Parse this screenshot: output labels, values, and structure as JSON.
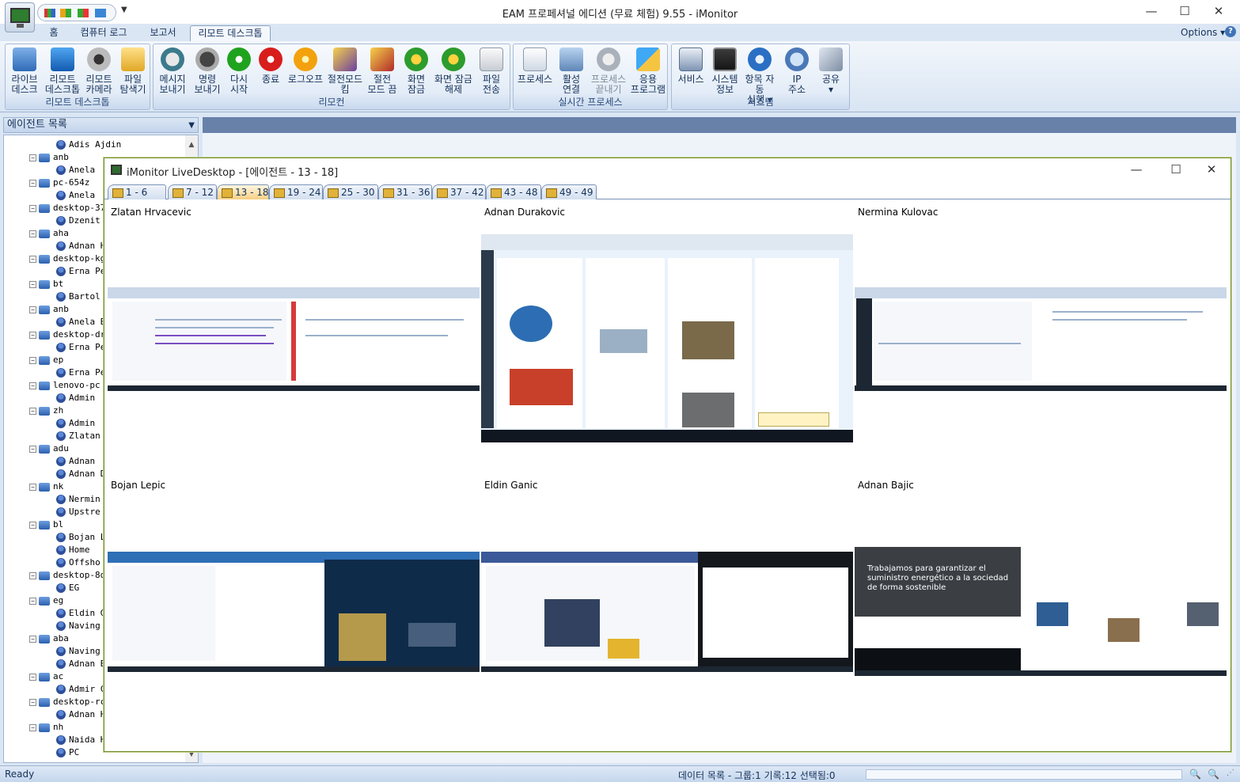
{
  "app": {
    "title": "EAM 프로페셔널 에디션 (무료 체험) 9.55 - iMonitor",
    "options_label": "Options",
    "help_glyph": "?"
  },
  "ribbon_tabs": [
    {
      "label": "홈",
      "active": false
    },
    {
      "label": "컴퓨터 로그",
      "active": false
    },
    {
      "label": "보고서",
      "active": false
    },
    {
      "label": "리모트 데스크톱",
      "active": true
    }
  ],
  "ribbon_groups": [
    {
      "label": "리모트 데스크톱",
      "buttons": [
        {
          "label": "라이브\n데스크",
          "icon": "monitor-icon"
        },
        {
          "label": "리모트\n데스크톱",
          "icon": "remote-desktop-icon"
        },
        {
          "label": "리모트\n카메라",
          "icon": "webcam-icon"
        },
        {
          "label": "파일\n탐색기",
          "icon": "folder-icon"
        }
      ]
    },
    {
      "label": "리모컨",
      "buttons": [
        {
          "label": "메시지\n보내기",
          "icon": "message-icon"
        },
        {
          "label": "명령\n보내기",
          "icon": "command-icon"
        },
        {
          "label": "다시\n시작",
          "icon": "restart-icon"
        },
        {
          "label": "종료",
          "icon": "power-icon"
        },
        {
          "label": "로그오프",
          "icon": "logoff-icon"
        },
        {
          "label": "절전모드\n킴",
          "icon": "sleep-on-icon"
        },
        {
          "label": "절전\n모드 끔",
          "icon": "sleep-off-icon"
        },
        {
          "label": "화면\n잠금",
          "icon": "lock-screen-icon"
        },
        {
          "label": "화면 잠금\n해제",
          "icon": "unlock-screen-icon"
        },
        {
          "label": "파일\n전송",
          "icon": "file-transfer-icon"
        }
      ]
    },
    {
      "label": "실시간 프로세스",
      "buttons": [
        {
          "label": "프로세스",
          "icon": "process-icon"
        },
        {
          "label": "활성\n연결",
          "icon": "connection-icon"
        },
        {
          "label": "프로세스\n끝내기",
          "icon": "kill-process-icon",
          "disabled": true
        },
        {
          "label": "응용\n프로그램",
          "icon": "application-icon"
        }
      ]
    },
    {
      "label": "시스템",
      "buttons": [
        {
          "label": "서비스",
          "icon": "services-icon"
        },
        {
          "label": "시스템\n정보",
          "icon": "system-info-icon"
        },
        {
          "label": "항목 자동\n실행 ▾",
          "icon": "autorun-icon"
        },
        {
          "label": "IP\n주소",
          "icon": "ip-address-icon"
        },
        {
          "label": "공유\n▾",
          "icon": "share-icon"
        }
      ]
    }
  ],
  "agent_pane": {
    "title": "에이전트 목록",
    "nodes": [
      {
        "label": "Adis Ajdin",
        "level": 2
      },
      {
        "label": "anb",
        "level": 1
      },
      {
        "label": "Anela",
        "level": 2
      },
      {
        "label": "pc-654z",
        "level": 1
      },
      {
        "label": "Anela",
        "level": 2
      },
      {
        "label": "desktop-37",
        "level": 1
      },
      {
        "label": "Dzenit",
        "level": 2
      },
      {
        "label": "aha",
        "level": 1
      },
      {
        "label": "Adnan H",
        "level": 2
      },
      {
        "label": "desktop-kg",
        "level": 1
      },
      {
        "label": "Erna Pe",
        "level": 2
      },
      {
        "label": "bt",
        "level": 1
      },
      {
        "label": "Bartol",
        "level": 2
      },
      {
        "label": "anb",
        "level": 1
      },
      {
        "label": "Anela B",
        "level": 2
      },
      {
        "label": "desktop-dr",
        "level": 1
      },
      {
        "label": "Erna Pe",
        "level": 2
      },
      {
        "label": "ep",
        "level": 1
      },
      {
        "label": "Erna Pe",
        "level": 2
      },
      {
        "label": "lenovo-pc",
        "level": 1
      },
      {
        "label": "Admin",
        "level": 2
      },
      {
        "label": "zh",
        "level": 1
      },
      {
        "label": "Admin",
        "level": 2
      },
      {
        "label": "Zlatan",
        "level": 2
      },
      {
        "label": "adu",
        "level": 1
      },
      {
        "label": "Adnan",
        "level": 2
      },
      {
        "label": "Adnan D",
        "level": 2
      },
      {
        "label": "nk",
        "level": 1
      },
      {
        "label": "Nermin",
        "level": 2
      },
      {
        "label": "Upstre",
        "level": 2
      },
      {
        "label": "bl",
        "level": 1
      },
      {
        "label": "Bojan L",
        "level": 2
      },
      {
        "label": "Home",
        "level": 2
      },
      {
        "label": "Offsho",
        "level": 2
      },
      {
        "label": "desktop-8q",
        "level": 1
      },
      {
        "label": "EG",
        "level": 2
      },
      {
        "label": "eg",
        "level": 1
      },
      {
        "label": "Eldin G",
        "level": 2
      },
      {
        "label": "Naving",
        "level": 2
      },
      {
        "label": "aba",
        "level": 1
      },
      {
        "label": "Naving",
        "level": 2
      },
      {
        "label": "Adnan B",
        "level": 2
      },
      {
        "label": "ac",
        "level": 1
      },
      {
        "label": "Admir C",
        "level": 2
      },
      {
        "label": "desktop-rc",
        "level": 1
      },
      {
        "label": "Adnan H",
        "level": 2
      },
      {
        "label": "nh",
        "level": 1
      },
      {
        "label": "Naida H",
        "level": 2
      },
      {
        "label": "PC",
        "level": 2
      }
    ]
  },
  "live_desktop": {
    "title": "iMonitor LiveDesktop - [에이전트 - 13 - 18]",
    "tabs": [
      {
        "label": "1 - 6",
        "selected": false
      },
      {
        "label": "7 - 12",
        "selected": false
      },
      {
        "label": "13 - 18",
        "selected": true
      },
      {
        "label": "19 - 24",
        "selected": false
      },
      {
        "label": "25 - 30",
        "selected": false
      },
      {
        "label": "31 - 36",
        "selected": false
      },
      {
        "label": "37 - 42",
        "selected": false
      },
      {
        "label": "43 - 48",
        "selected": false
      },
      {
        "label": "49 - 49",
        "selected": false
      }
    ],
    "agents": [
      {
        "name": "Zlatan Hrvacevic",
        "screen": "dual-monitor-desktop"
      },
      {
        "name": "Adnan Durakovic",
        "screen": "tweetdeck-browser"
      },
      {
        "name": "Nermina Kulovac",
        "screen": "dual-monitor-desktop"
      },
      {
        "name": "Bojan Lepic",
        "screen": "dual-monitor-desktop"
      },
      {
        "name": "Eldin Ganic",
        "screen": "dual-monitor-desktop"
      },
      {
        "name": "Adnan Bajic",
        "screen": "dual-monitor-desktop"
      }
    ],
    "thumbnail_caption": "Trabajamos para garantizar el suministro energético a la sociedad de forma sostenible"
  },
  "status": {
    "ready": "Ready",
    "info": "데이터 목록 - 그룹:1  기록:12  선택됨:0"
  }
}
